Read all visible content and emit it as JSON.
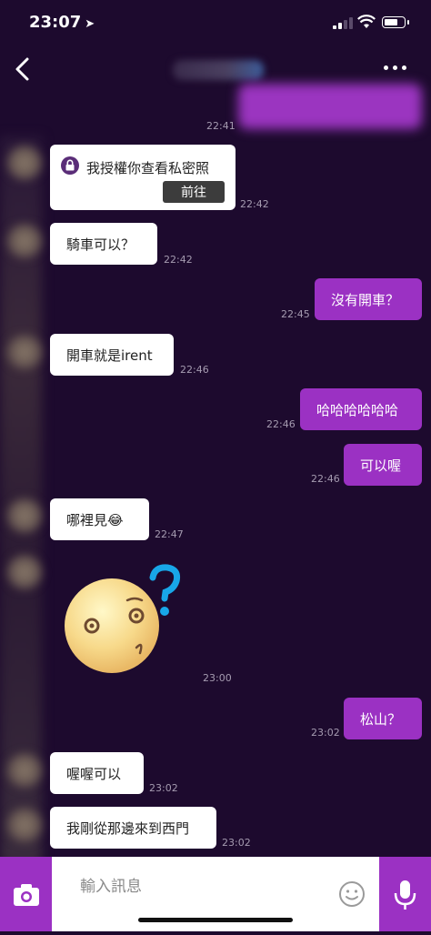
{
  "status": {
    "time": "23:07"
  },
  "header": {
    "title": ""
  },
  "messages": {
    "m0_time": "22:41",
    "private_card": {
      "text": "我授權你查看私密照",
      "button": "前往",
      "time": "22:42"
    },
    "m2": {
      "text": "騎車可以？",
      "time": "22:42"
    },
    "m3": {
      "text": "沒有開車？",
      "time": "22:45"
    },
    "m4": {
      "text": "開車就是irent",
      "time": "22:46"
    },
    "m5": {
      "text": "哈哈哈哈哈哈",
      "time": "22:46"
    },
    "m6": {
      "text": "可以喔",
      "time": "22:46"
    },
    "m7": {
      "text": "哪裡見😂",
      "time": "22:47"
    },
    "sticker": {
      "time": "23:00",
      "icon": "confused-face-sticker"
    },
    "m9": {
      "text": "松山？",
      "time": "23:02"
    },
    "m10": {
      "text": "喔喔可以",
      "time": "23:02"
    },
    "m11": {
      "text": "我剛從那邊來到西門",
      "time": "23:02"
    }
  },
  "input": {
    "placeholder": "輸入訊息"
  },
  "colors": {
    "accent": "#9b31c3",
    "background": "#1d0a2e",
    "incoming": "#ffffff"
  }
}
